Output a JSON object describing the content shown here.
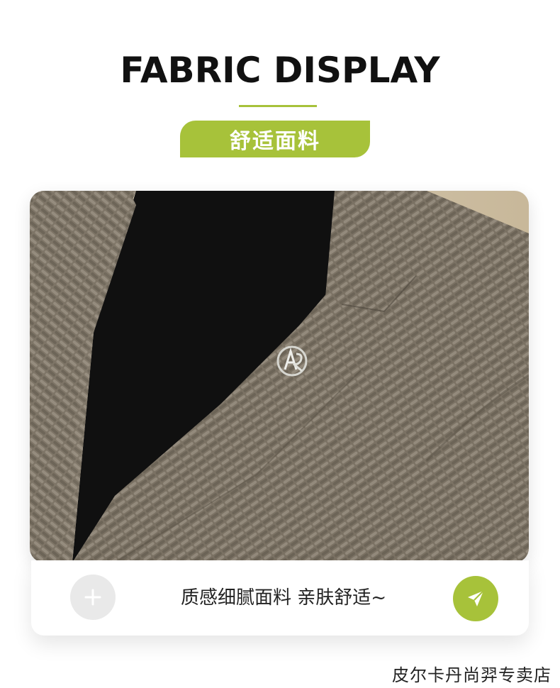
{
  "header": {
    "title": "FABRIC DISPLAY",
    "badge": "舒适面料"
  },
  "photo": {
    "subject": "close-up of textured waffle-knit blazer lapel with metal brooch over black turtleneck"
  },
  "caption": {
    "text": "质感细腻面料 亲肤舒适~",
    "plus_icon": "plus-icon",
    "send_icon": "send-icon"
  },
  "footer": {
    "store_name": "皮尔卡丹尚羿专卖店"
  },
  "colors": {
    "accent": "#a7c23a",
    "fabric": "#7b7264",
    "sweater": "#0f0f0f"
  }
}
